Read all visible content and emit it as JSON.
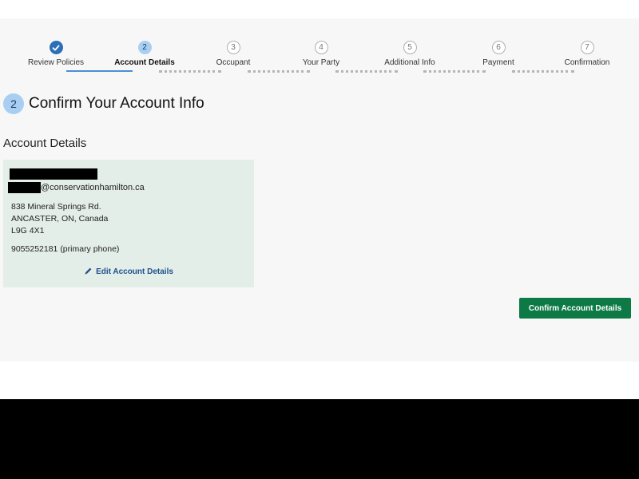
{
  "stepper": {
    "steps": [
      {
        "number": "",
        "label": "Review Policies",
        "state": "complete",
        "icon": "check-icon"
      },
      {
        "number": "2",
        "label": "Account Details",
        "state": "current"
      },
      {
        "number": "3",
        "label": "Occupant",
        "state": "pending"
      },
      {
        "number": "4",
        "label": "Your Party",
        "state": "pending"
      },
      {
        "number": "5",
        "label": "Additional Info",
        "state": "pending"
      },
      {
        "number": "6",
        "label": "Payment",
        "state": "pending"
      },
      {
        "number": "7",
        "label": "Confirmation",
        "state": "pending"
      }
    ]
  },
  "section": {
    "number": "2",
    "title": "Confirm Your Account Info"
  },
  "account": {
    "heading": "Account Details",
    "email_domain": "@conservationhamilton.ca",
    "address_line1": "838 Mineral Springs Rd.",
    "address_line2": "ANCASTER, ON, Canada",
    "postal_code": "L9G 4X1",
    "phone": "9055252181 (primary phone)",
    "edit_label": "Edit Account Details",
    "edit_icon": "pencil-icon"
  },
  "actions": {
    "confirm_label": "Confirm Account Details"
  },
  "colors": {
    "panel_bg": "#f7f7f7",
    "card_bg": "#e3eee8",
    "accent_blue": "#2c6fb7",
    "current_step": "#a8cff2",
    "confirm_green": "#0d7a45"
  }
}
